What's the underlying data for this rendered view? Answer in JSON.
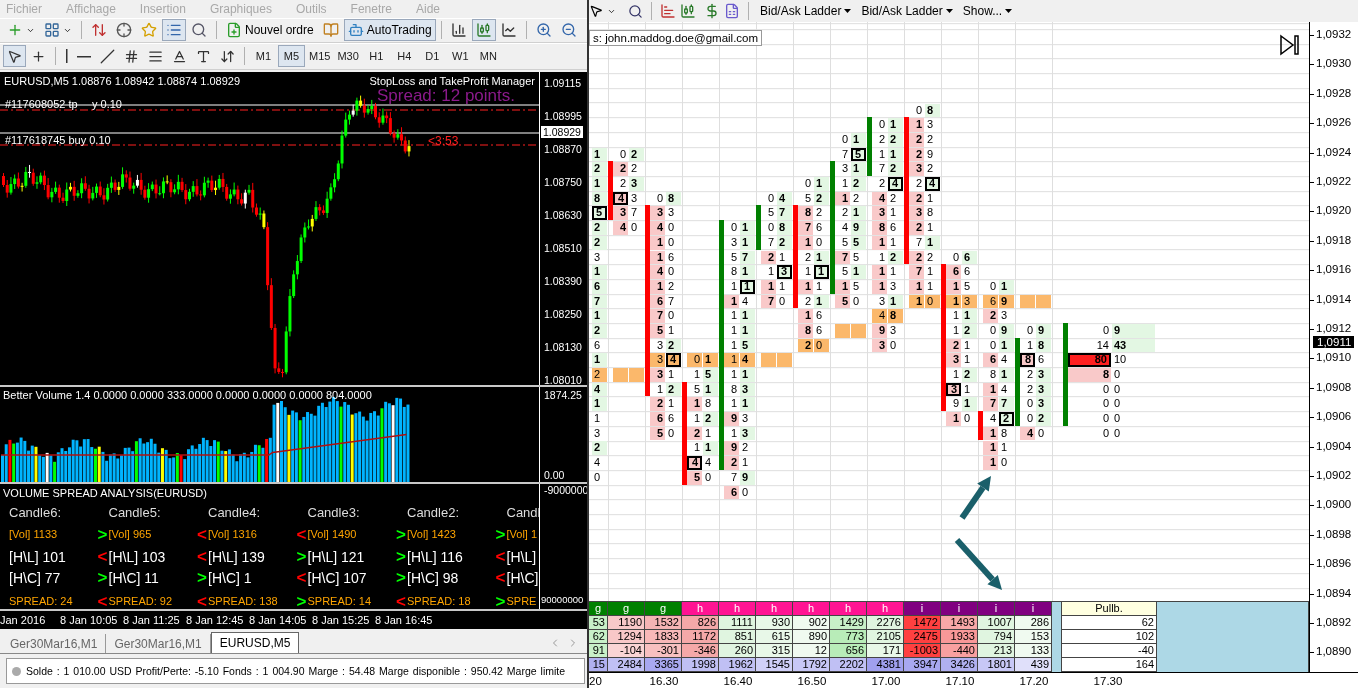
{
  "menu": [
    "Fichier",
    "Affichage",
    "Insertion",
    "Graphiques",
    "Outils",
    "Fenetre",
    "Aide"
  ],
  "toolbar": [
    {
      "pressed": false
    },
    {
      "pressed": false
    },
    {
      "pressed": false
    },
    {
      "pressed": false
    },
    {
      "pressed": false
    },
    {
      "pressed": true
    },
    {
      "pressed": false
    },
    {
      "label": "Nouvel ordre",
      "pressed": false
    },
    {
      "pressed": false
    },
    {
      "label": "AutoTrading",
      "pressed": true
    },
    {
      "pressed": false
    },
    {
      "pressed": true
    },
    {
      "pressed": false
    },
    {
      "pressed": false
    },
    {
      "pressed": false
    }
  ],
  "draw_tools": [
    {
      "pressed": true
    },
    {
      "pressed": false
    },
    {
      "pressed": false
    },
    {
      "pressed": false
    },
    {
      "pressed": false
    },
    {
      "pressed": false
    },
    {
      "pressed": false
    },
    {
      "pressed": false
    },
    {
      "pressed": false
    },
    {
      "pressed": false
    }
  ],
  "timeframes": [
    {
      "label": "M1",
      "selected": false
    },
    {
      "label": "M5",
      "selected": true
    },
    {
      "label": "M15",
      "selected": false
    },
    {
      "label": "M30",
      "selected": false
    },
    {
      "label": "H1",
      "selected": false
    },
    {
      "label": "H4",
      "selected": false
    },
    {
      "label": "D1",
      "selected": false
    },
    {
      "label": "W1",
      "selected": false
    },
    {
      "label": "MN",
      "selected": false
    }
  ],
  "chart": {
    "header": "EURUSD,M5  1.08876 1.08942 1.08874 1.08929",
    "expert": "StopLoss and TakeProfit Manager",
    "spread": "Spread: 12 points.",
    "order_line_1": [
      "#117608052 tp",
      "y 0.10"
    ],
    "order_line_2": "#117618745 buy 0.10",
    "timer": "<3:53",
    "price_labels": [
      "1.09115",
      "1.08995",
      "1.08870",
      "1.08750",
      "1.08630",
      "1.08510",
      "1.08390",
      "1.08250",
      "1.08130",
      "1.08010"
    ],
    "current_price": "1.08929"
  },
  "volume": {
    "title": "Better Volume 1.4 0.0000 0.0000 333.0000 0.0000 0.0000 0.0000 804.0000",
    "axis": [
      "1874.25",
      "0.00"
    ]
  },
  "vsa": {
    "title": "VOLUME SPREAD ANALYSIS(EURUSD)",
    "axis": [
      "-9000000",
      "90000000"
    ],
    "columns": [
      {
        "title": "Candle6:",
        "rows": [
          {
            "kind": "vol",
            "text": "[Vol] 1133"
          },
          {
            "kind": "range",
            "text": "[H\\L] 101"
          },
          {
            "kind": "range",
            "text": "[H\\C] 77"
          },
          {
            "kind": "spread",
            "text": "SPREAD: 24"
          }
        ]
      },
      {
        "title": "Candle5:",
        "rows": [
          {
            "kind": "vol",
            "arrow": ">",
            "color": "#00ff00",
            "text": "[Vol] 965"
          },
          {
            "kind": "range",
            "arrow": "<",
            "color": "#ff0000",
            "text": "[H\\L] 103"
          },
          {
            "kind": "range",
            "arrow": ">",
            "color": "#00ff00",
            "text": "[H\\C] 11"
          },
          {
            "kind": "spread",
            "arrow": "<",
            "color": "#ff0000",
            "text": "SPREAD: 92"
          }
        ]
      },
      {
        "title": "Candle4:",
        "rows": [
          {
            "kind": "vol",
            "arrow": "<",
            "color": "#ff0000",
            "text": "[Vol] 1316"
          },
          {
            "kind": "range",
            "arrow": "<",
            "color": "#ff0000",
            "text": "[H\\L] 139"
          },
          {
            "kind": "range",
            "arrow": ">",
            "color": "#00ff00",
            "text": "[H\\C] 1"
          },
          {
            "kind": "spread",
            "arrow": "<",
            "color": "#ff0000",
            "text": "SPREAD: 138"
          }
        ]
      },
      {
        "title": "Candle3:",
        "rows": [
          {
            "kind": "vol",
            "arrow": "<",
            "color": "#ff0000",
            "text": "[Vol] 1490"
          },
          {
            "kind": "range",
            "arrow": ">",
            "color": "#00ff00",
            "text": "[H\\L] 121"
          },
          {
            "kind": "range",
            "arrow": "<",
            "color": "#ff0000",
            "text": "[H\\C] 107"
          },
          {
            "kind": "spread",
            "arrow": ">",
            "color": "#00ff00",
            "text": "SPREAD: 14"
          }
        ]
      },
      {
        "title": "Candle2:",
        "rows": [
          {
            "kind": "vol",
            "arrow": ">",
            "color": "#00ff00",
            "text": "[Vol] 1423"
          },
          {
            "kind": "range",
            "arrow": ">",
            "color": "#00ff00",
            "text": "[H\\L] 116"
          },
          {
            "kind": "range",
            "arrow": ">",
            "color": "#00ff00",
            "text": "[H\\C] 98"
          },
          {
            "kind": "spread",
            "arrow": "<",
            "color": "#ff0000",
            "text": "SPREAD: 18"
          }
        ]
      },
      {
        "title": "Candl",
        "rows": [
          {
            "kind": "vol",
            "arrow": ">",
            "color": "#00ff00",
            "text": "[Vol] 1"
          },
          {
            "kind": "range",
            "arrow": "<",
            "color": "#ff0000",
            "text": "[H\\L]"
          },
          {
            "kind": "range",
            "arrow": "<",
            "color": "#ff0000",
            "text": "[H\\C]"
          },
          {
            "kind": "spread",
            "arrow": ">",
            "color": "#00ff00",
            "text": "SPRE"
          }
        ]
      }
    ]
  },
  "time_axis": [
    "Jan 2016",
    "8 Jan 10:05",
    "8 Jan 11:25",
    "8 Jan 12:45",
    "8 Jan 14:05",
    "8 Jan 15:25",
    "8 Jan 16:45"
  ],
  "chart_tabs": [
    {
      "label": "Ger30Mar16,M1",
      "selected": false
    },
    {
      "label": "Ger30Mar16,M1",
      "selected": false
    },
    {
      "label": "EURUSD,M5",
      "selected": true
    }
  ],
  "status": "Solde : 1 010.00 USD Profit/Perte: -5.10 Fonds : 1 004.90 Marge : 54.48 Marge disponible : 950.42 Marge limite",
  "ladder_menus": [
    "Bid/Ask Ladder",
    "Bid/Ask Ladder",
    "Show..."
  ],
  "tooltip": "s: john.maddog.doe@gmail.com",
  "footprint": [
    {
      "kind": "edge",
      "cells": [
        null,
        null,
        null,
        {
          "ask": "1",
          "ask_bold": true
        },
        {
          "ask": "2",
          "ask_bold": true
        },
        {
          "ask": "1",
          "ask_bold": true
        },
        {
          "ask": "8",
          "ask_bold": true
        },
        {
          "ask": "5",
          "ask_bold": true,
          "ask_boxed": true
        },
        {
          "ask": "2",
          "ask_bold": true
        },
        {
          "ask": "2",
          "ask_bold": true
        },
        {
          "ask": "3",
          "ask_bold": false
        },
        {
          "ask": "1",
          "ask_bold": true
        },
        {
          "ask": "6",
          "ask_bold": true
        },
        {
          "ask": "7",
          "ask_bold": true
        },
        {
          "ask": "1",
          "ask_bold": true
        },
        {
          "ask": "2",
          "ask_bold": true
        },
        {
          "ask": "6",
          "ask_bold": false
        },
        {
          "ask": "1",
          "ask_bold": true
        },
        {
          "ask": "2",
          "ask_bold": false,
          "poc": true
        },
        {
          "ask": "4",
          "ask_bold": true
        },
        {
          "ask": "1",
          "ask_bold": true
        },
        {
          "ask": "1",
          "ask_bold": false
        },
        {
          "ask": "3",
          "ask_bold": false
        },
        {
          "ask": "2",
          "ask_bold": true
        },
        {
          "ask": "4",
          "ask_bold": false
        },
        {
          "ask": "0",
          "ask_bold": false
        }
      ]
    },
    {
      "kind": "pair",
      "color": "#ff0000",
      "cells": [
        null,
        null,
        null,
        {
          "bid": "0",
          "ask": "2",
          "bid_bold": false,
          "ask_bold": true
        },
        {
          "bid": "2",
          "ask": "2",
          "bid_bold": true,
          "ask_bold": false,
          "bar": true
        },
        {
          "bid": "2",
          "ask": "3",
          "bid_bold": false,
          "ask_bold": true,
          "bar": true
        },
        {
          "bid": "4",
          "ask": "3",
          "bid_bold": true,
          "ask_bold": false,
          "bid_boxed": true,
          "bar": true
        },
        {
          "bid": "3",
          "ask": "7",
          "bid_bold": true,
          "ask_bold": false,
          "bar": true
        },
        {
          "bid": "4",
          "ask": "0",
          "bid_bold": true,
          "ask_bold": false
        },
        null,
        null,
        null,
        null,
        null,
        null,
        null,
        null,
        null,
        {
          "poc": true
        }
      ]
    },
    {
      "kind": "pair",
      "color": "#ff0000",
      "cells": [
        null,
        null,
        null,
        null,
        null,
        null,
        {
          "bid": "0",
          "ask": "8",
          "bid_bold": false,
          "ask_bold": true
        },
        {
          "bid": "3",
          "ask": "3",
          "bid_bold": true,
          "ask_bold": false,
          "bar": true
        },
        {
          "bid": "4",
          "ask": "0",
          "bid_bold": true,
          "ask_bold": false,
          "bar": true
        },
        {
          "bid": "1",
          "ask": "0",
          "bid_bold": true,
          "ask_bold": false,
          "bar": true
        },
        {
          "bid": "1",
          "ask": "6",
          "bid_bold": true,
          "ask_bold": false,
          "bar": true
        },
        {
          "bid": "4",
          "ask": "0",
          "bid_bold": true,
          "ask_bold": false,
          "bar": true
        },
        {
          "bid": "1",
          "ask": "2",
          "bid_bold": true,
          "ask_bold": false,
          "bar": true
        },
        {
          "bid": "6",
          "ask": "7",
          "bid_bold": true,
          "ask_bold": false,
          "bar": true
        },
        {
          "bid": "7",
          "ask": "0",
          "bid_bold": true,
          "ask_bold": false,
          "bar": true
        },
        {
          "bid": "5",
          "ask": "1",
          "bid_bold": true,
          "ask_bold": false,
          "bar": true
        },
        {
          "bid": "3",
          "ask": "2",
          "bid_bold": false,
          "ask_bold": true,
          "bar": true
        },
        {
          "bid": "3",
          "ask": "4",
          "bid_bold": false,
          "ask_bold": true,
          "ask_boxed": true,
          "poc": true,
          "bar": true
        },
        {
          "bid": "3",
          "ask": "1",
          "bid_bold": true,
          "ask_bold": false,
          "bar": true
        },
        {
          "bid": "1",
          "ask": "2",
          "bid_bold": false,
          "ask_bold": true,
          "bar": true
        },
        {
          "bid": "2",
          "ask": "1",
          "bid_bold": true,
          "ask_bold": false
        },
        {
          "bid": "6",
          "ask": "6",
          "bid_bold": true,
          "ask_bold": false
        },
        {
          "bid": "5",
          "ask": "0",
          "bid_bold": true,
          "ask_bold": false
        }
      ]
    },
    {
      "kind": "pair",
      "color": "#ff0000",
      "cells": [
        null,
        null,
        null,
        null,
        null,
        null,
        null,
        null,
        null,
        null,
        null,
        null,
        null,
        null,
        null,
        null,
        null,
        {
          "bid": "0",
          "ask": "1",
          "bid_bold": false,
          "ask_bold": true,
          "poc": true
        },
        {
          "bid": "1",
          "ask": "5",
          "bid_bold": false,
          "ask_bold": true
        },
        {
          "bid": "5",
          "ask": "1",
          "bid_bold": false,
          "ask_bold": true,
          "bar": true
        },
        {
          "bid": "1",
          "ask": "8",
          "bid_bold": true,
          "ask_bold": false,
          "bar": true
        },
        {
          "bid": "1",
          "ask": "2",
          "bid_bold": false,
          "ask_bold": true,
          "bar": true
        },
        {
          "bid": "2",
          "ask": "1",
          "bid_bold": true,
          "ask_bold": false,
          "bar": true
        },
        {
          "bid": "1",
          "ask": "1",
          "bid_bold": false,
          "ask_bold": true,
          "bar": true
        },
        {
          "bid": "4",
          "ask": "4",
          "bid_bold": true,
          "ask_bold": false,
          "bid_boxed": true,
          "bar": true
        },
        {
          "bid": "5",
          "ask": "0",
          "bid_bold": true,
          "ask_bold": false,
          "bar": true
        }
      ]
    },
    {
      "kind": "pair",
      "color": "#008000",
      "cells": [
        null,
        null,
        null,
        null,
        null,
        null,
        null,
        null,
        {
          "bid": "0",
          "ask": "1",
          "bid_bold": false,
          "ask_bold": true,
          "bar": true
        },
        {
          "bid": "3",
          "ask": "1",
          "bid_bold": false,
          "ask_bold": true,
          "bar": true
        },
        {
          "bid": "5",
          "ask": "7",
          "bid_bold": false,
          "ask_bold": true,
          "bar": true
        },
        {
          "bid": "8",
          "ask": "1",
          "bid_bold": false,
          "ask_bold": true,
          "bar": true
        },
        {
          "bid": "1",
          "ask": "1",
          "bid_bold": false,
          "ask_bold": true,
          "ask_boxed": true,
          "bar": true
        },
        {
          "bid": "1",
          "ask": "4",
          "bid_bold": true,
          "ask_bold": false,
          "bar": true
        },
        {
          "bid": "1",
          "ask": "1",
          "bid_bold": false,
          "ask_bold": true,
          "bar": true
        },
        {
          "bid": "1",
          "ask": "1",
          "bid_bold": false,
          "ask_bold": true,
          "bar": true
        },
        {
          "bid": "1",
          "ask": "5",
          "bid_bold": false,
          "ask_bold": true,
          "bar": true
        },
        {
          "bid": "1",
          "ask": "4",
          "bid_bold": false,
          "ask_bold": true,
          "poc": true,
          "bar": true
        },
        {
          "bid": "1",
          "ask": "1",
          "bid_bold": false,
          "ask_bold": true,
          "bar": true
        },
        {
          "bid": "8",
          "ask": "3",
          "bid_bold": false,
          "ask_bold": true,
          "bar": true
        },
        {
          "bid": "1",
          "ask": "1",
          "bid_bold": false,
          "ask_bold": true,
          "bar": true
        },
        {
          "bid": "9",
          "ask": "3",
          "bid_bold": true,
          "ask_bold": false,
          "bar": true
        },
        {
          "bid": "1",
          "ask": "3",
          "bid_bold": false,
          "ask_bold": true,
          "bar": true
        },
        {
          "bid": "9",
          "ask": "2",
          "bid_bold": true,
          "ask_bold": false,
          "bar": true
        },
        {
          "bid": "2",
          "ask": "1",
          "bid_bold": true,
          "ask_bold": false,
          "bar": true
        },
        {
          "bid": "7",
          "ask": "9",
          "bid_bold": false,
          "ask_bold": true
        },
        {
          "bid": "6",
          "ask": "0",
          "bid_bold": true,
          "ask_bold": false
        }
      ]
    },
    {
      "kind": "pair",
      "color": "#008000",
      "cells": [
        null,
        null,
        null,
        null,
        null,
        null,
        {
          "bid": "0",
          "ask": "4",
          "bid_bold": false,
          "ask_bold": true
        },
        {
          "bid": "5",
          "ask": "7",
          "bid_bold": false,
          "ask_bold": true,
          "bar": true
        },
        {
          "bid": "0",
          "ask": "8",
          "bid_bold": false,
          "ask_bold": true,
          "bar": true
        },
        {
          "bid": "7",
          "ask": "2",
          "bid_bold": false,
          "ask_bold": true,
          "bar": true
        },
        {
          "bid": "2",
          "ask": "1",
          "bid_bold": true,
          "ask_bold": false
        },
        {
          "bid": "1",
          "ask": "3",
          "bid_bold": false,
          "ask_bold": true,
          "ask_boxed": true
        },
        {
          "bid": "1",
          "ask": "1",
          "bid_bold": true,
          "ask_bold": false
        },
        {
          "bid": "7",
          "ask": "0",
          "bid_bold": true,
          "ask_bold": false
        },
        null,
        null,
        null,
        {
          "poc": true
        }
      ]
    },
    {
      "kind": "pair",
      "color": "#ff0000",
      "cells": [
        null,
        null,
        null,
        null,
        null,
        {
          "bid": "0",
          "ask": "1",
          "bid_bold": false,
          "ask_bold": true
        },
        {
          "bid": "5",
          "ask": "2",
          "bid_bold": false,
          "ask_bold": true
        },
        {
          "bid": "8",
          "ask": "2",
          "bid_bold": true,
          "ask_bold": false,
          "bar": true
        },
        {
          "bid": "7",
          "ask": "6",
          "bid_bold": true,
          "ask_bold": false,
          "bar": true
        },
        {
          "bid": "1",
          "ask": "0",
          "bid_bold": true,
          "ask_bold": false,
          "bar": true
        },
        {
          "bid": "2",
          "ask": "1",
          "bid_bold": false,
          "ask_bold": true,
          "bar": true
        },
        {
          "bid": "1",
          "ask": "1",
          "bid_bold": false,
          "ask_bold": true,
          "ask_boxed": true,
          "bar": true
        },
        {
          "bid": "1",
          "ask": "1",
          "bid_bold": true,
          "ask_bold": false,
          "bar": true
        },
        {
          "bid": "2",
          "ask": "1",
          "bid_bold": false,
          "ask_bold": true,
          "bar": true
        },
        {
          "bid": "1",
          "ask": "6",
          "bid_bold": true,
          "ask_bold": false
        },
        {
          "bid": "8",
          "ask": "6",
          "bid_bold": true,
          "ask_bold": false
        },
        {
          "bid": "2",
          "ask": "0",
          "bid_bold": true,
          "ask_bold": false,
          "poc": true
        }
      ]
    },
    {
      "kind": "pair",
      "color": "#008000",
      "cells": [
        null,
        null,
        {
          "bid": "0",
          "ask": "1",
          "bid_bold": false,
          "ask_bold": true
        },
        {
          "bid": "7",
          "ask": "5",
          "bid_bold": false,
          "ask_bold": true,
          "ask_boxed": true
        },
        {
          "bid": "3",
          "ask": "1",
          "bid_bold": false,
          "ask_bold": true,
          "bar": true
        },
        {
          "bid": "1",
          "ask": "2",
          "bid_bold": false,
          "ask_bold": true,
          "bar": true
        },
        {
          "bid": "1",
          "ask": "2",
          "bid_bold": true,
          "ask_bold": false,
          "bar": true
        },
        {
          "bid": "2",
          "ask": "1",
          "bid_bold": false,
          "ask_bold": true,
          "bar": true
        },
        {
          "bid": "4",
          "ask": "9",
          "bid_bold": false,
          "ask_bold": true,
          "bar": true
        },
        {
          "bid": "5",
          "ask": "5",
          "bid_bold": false,
          "ask_bold": true,
          "bar": true
        },
        {
          "bid": "7",
          "ask": "5",
          "bid_bold": true,
          "ask_bold": false,
          "bar": true
        },
        {
          "bid": "5",
          "ask": "1",
          "bid_bold": false,
          "ask_bold": true,
          "bar": true
        },
        {
          "bid": "1",
          "ask": "5",
          "bid_bold": true,
          "ask_bold": false,
          "bar": true
        },
        {
          "bid": "5",
          "ask": "0",
          "bid_bold": true,
          "ask_bold": false
        },
        null,
        {
          "poc": true
        }
      ]
    },
    {
      "kind": "pair",
      "color": "#008000",
      "cells": [
        null,
        {
          "bid": "0",
          "ask": "1",
          "bid_bold": false,
          "ask_bold": true,
          "bar": true
        },
        {
          "bid": "2",
          "ask": "2",
          "bid_bold": false,
          "ask_bold": true,
          "bar": true
        },
        {
          "bid": "1",
          "ask": "1",
          "bid_bold": false,
          "ask_bold": true,
          "bar": true
        },
        {
          "bid": "7",
          "ask": "2",
          "bid_bold": false,
          "ask_bold": true,
          "bar": true
        },
        {
          "bid": "2",
          "ask": "4",
          "bid_bold": false,
          "ask_bold": true,
          "ask_boxed": true
        },
        {
          "bid": "4",
          "ask": "2",
          "bid_bold": true,
          "ask_bold": false
        },
        {
          "bid": "3",
          "ask": "1",
          "bid_bold": true,
          "ask_bold": false
        },
        {
          "bid": "8",
          "ask": "6",
          "bid_bold": true,
          "ask_bold": false
        },
        {
          "bid": "1",
          "ask": "1",
          "bid_bold": true,
          "ask_bold": false
        },
        {
          "bid": "1",
          "ask": "2",
          "bid_bold": false,
          "ask_bold": true
        },
        {
          "bid": "1",
          "ask": "1",
          "bid_bold": true,
          "ask_bold": false
        },
        {
          "bid": "1",
          "ask": "3",
          "bid_bold": true,
          "ask_bold": false
        },
        {
          "bid": "3",
          "ask": "1",
          "bid_bold": false,
          "ask_bold": true
        },
        {
          "bid": "4",
          "ask": "8",
          "bid_bold": false,
          "ask_bold": true,
          "poc": true
        },
        {
          "bid": "9",
          "ask": "3",
          "bid_bold": true,
          "ask_bold": false
        },
        {
          "bid": "3",
          "ask": "0",
          "bid_bold": true,
          "ask_bold": false
        }
      ]
    },
    {
      "kind": "pair",
      "color": "#ff0000",
      "cells": [
        {
          "bid": "0",
          "ask": "8",
          "bid_bold": false,
          "ask_bold": true
        },
        {
          "bid": "1",
          "ask": "3",
          "bid_bold": true,
          "ask_bold": false,
          "bar": true
        },
        {
          "bid": "2",
          "ask": "2",
          "bid_bold": true,
          "ask_bold": false,
          "bar": true
        },
        {
          "bid": "2",
          "ask": "9",
          "bid_bold": true,
          "ask_bold": false,
          "bar": true
        },
        {
          "bid": "3",
          "ask": "2",
          "bid_bold": true,
          "ask_bold": false,
          "bar": true
        },
        {
          "bid": "2",
          "ask": "4",
          "bid_bold": false,
          "ask_bold": true,
          "ask_boxed": true,
          "bar": true
        },
        {
          "bid": "2",
          "ask": "1",
          "bid_bold": true,
          "ask_bold": false,
          "bar": true
        },
        {
          "bid": "3",
          "ask": "8",
          "bid_bold": true,
          "ask_bold": false,
          "bar": true
        },
        {
          "bid": "2",
          "ask": "1",
          "bid_bold": true,
          "ask_bold": false,
          "bar": true
        },
        {
          "bid": "7",
          "ask": "1",
          "bid_bold": false,
          "ask_bold": true,
          "bar": true
        },
        {
          "bid": "2",
          "ask": "2",
          "bid_bold": true,
          "ask_bold": false,
          "bar": true
        },
        {
          "bid": "7",
          "ask": "1",
          "bid_bold": true,
          "ask_bold": false
        },
        {
          "bid": "1",
          "ask": "1",
          "bid_bold": true,
          "ask_bold": false
        },
        {
          "bid": "1",
          "ask": "0",
          "bid_bold": true,
          "ask_bold": false,
          "poc": true
        }
      ]
    },
    {
      "kind": "pair",
      "color": "#ff0000",
      "cells": [
        null,
        null,
        null,
        null,
        null,
        null,
        null,
        null,
        null,
        null,
        {
          "bid": "0",
          "ask": "6",
          "bid_bold": false,
          "ask_bold": true
        },
        {
          "bid": "6",
          "ask": "6",
          "bid_bold": true,
          "ask_bold": false,
          "bar": true
        },
        {
          "bid": "1",
          "ask": "5",
          "bid_bold": true,
          "ask_bold": false,
          "bar": true
        },
        {
          "bid": "1",
          "ask": "3",
          "bid_bold": true,
          "ask_bold": false,
          "poc": true,
          "bar": true
        },
        {
          "bid": "1",
          "ask": "1",
          "bid_bold": false,
          "ask_bold": true,
          "bar": true
        },
        {
          "bid": "1",
          "ask": "2",
          "bid_bold": false,
          "ask_bold": true,
          "bar": true
        },
        {
          "bid": "2",
          "ask": "1",
          "bid_bold": true,
          "ask_bold": false,
          "bar": true
        },
        {
          "bid": "3",
          "ask": "1",
          "bid_bold": true,
          "ask_bold": false,
          "bar": true
        },
        {
          "bid": "1",
          "ask": "2",
          "bid_bold": false,
          "ask_bold": true,
          "bar": true
        },
        {
          "bid": "3",
          "ask": "1",
          "bid_bold": true,
          "ask_bold": false,
          "bid_boxed": true,
          "bar": true
        },
        {
          "bid": "9",
          "ask": "1",
          "bid_bold": false,
          "ask_bold": true,
          "bar": true
        },
        {
          "bid": "1",
          "ask": "0",
          "bid_bold": true,
          "ask_bold": false
        }
      ]
    },
    {
      "kind": "pair",
      "color": "#ff0000",
      "cells": [
        null,
        null,
        null,
        null,
        null,
        null,
        null,
        null,
        null,
        null,
        null,
        null,
        {
          "bid": "0",
          "ask": "1",
          "bid_bold": false,
          "ask_bold": true
        },
        {
          "bid": "6",
          "ask": "9",
          "bid_bold": false,
          "ask_bold": true,
          "poc": true
        },
        {
          "bid": "2",
          "ask": "3",
          "bid_bold": true,
          "ask_bold": false
        },
        {
          "bid": "0",
          "ask": "9",
          "bid_bold": false,
          "ask_bold": true
        },
        {
          "bid": "0",
          "ask": "1",
          "bid_bold": false,
          "ask_bold": true
        },
        {
          "bid": "6",
          "ask": "4",
          "bid_bold": true,
          "ask_bold": false
        },
        {
          "bid": "8",
          "ask": "1",
          "bid_bold": false,
          "ask_bold": true
        },
        {
          "bid": "1",
          "ask": "4",
          "bid_bold": true,
          "ask_bold": false
        },
        {
          "bid": "7",
          "ask": "7",
          "bid_bold": true,
          "ask_bold": true
        },
        {
          "bid": "4",
          "ask": "2",
          "bid_bold": false,
          "ask_bold": true,
          "ask_boxed": true,
          "bar": true
        },
        {
          "bid": "1",
          "ask": "8",
          "bid_bold": true,
          "ask_bold": false,
          "bar": true
        },
        {
          "bid": "1",
          "ask": "1",
          "bid_bold": true,
          "ask_bold": false
        },
        {
          "bid": "1",
          "ask": "0",
          "bid_bold": true,
          "ask_bold": false
        }
      ]
    },
    {
      "kind": "pair",
      "color": "#008000",
      "cells": [
        null,
        null,
        null,
        null,
        null,
        null,
        null,
        null,
        null,
        null,
        null,
        null,
        null,
        {
          "poc": true
        },
        null,
        {
          "bid": "0",
          "ask": "9",
          "bid_bold": false,
          "ask_bold": true
        },
        {
          "bid": "1",
          "ask": "8",
          "bid_bold": false,
          "ask_bold": true,
          "bar": true
        },
        {
          "bid": "8",
          "ask": "6",
          "bid_bold": true,
          "ask_bold": false,
          "bid_boxed": true,
          "bar": true
        },
        {
          "bid": "2",
          "ask": "3",
          "bid_bold": false,
          "ask_bold": true,
          "bar": true
        },
        {
          "bid": "2",
          "ask": "3",
          "bid_bold": false,
          "ask_bold": true,
          "bar": true
        },
        {
          "bid": "0",
          "ask": "3",
          "bid_bold": false,
          "ask_bold": true,
          "bar": true
        },
        {
          "bid": "0",
          "ask": "2",
          "bid_bold": false,
          "ask_bold": true,
          "bar": true
        },
        {
          "bid": "4",
          "ask": "0",
          "bid_bold": true,
          "ask_bold": false
        }
      ]
    },
    {
      "kind": "ladder",
      "color": "#008000",
      "cells": [
        null,
        null,
        null,
        null,
        null,
        null,
        null,
        null,
        null,
        null,
        null,
        null,
        null,
        null,
        null,
        {
          "bid": "0",
          "ask": "9",
          "bid_bold": false,
          "ask_bold": true,
          "bar": true
        },
        {
          "bid": "14",
          "ask": "43",
          "bid_bold": false,
          "ask_bold": true,
          "bar": true
        },
        {
          "bid": "80",
          "ask": "10",
          "bid_bold": true,
          "ask_bold": false,
          "bid_boxed": true,
          "bar": true
        },
        {
          "bid": "8",
          "ask": "0",
          "bid_bold": true,
          "ask_bold": false,
          "bar": true
        },
        {
          "bid": "0",
          "ask": "0",
          "bid_bold": false,
          "ask_bold": false,
          "bar": true
        },
        {
          "bid": "0",
          "ask": "0",
          "bid_bold": false,
          "ask_bold": false,
          "bar": true
        },
        {
          "bid": "0",
          "ask": "0",
          "bid_bold": false,
          "ask_bold": false,
          "bar": true
        },
        {
          "bid": "0",
          "ask": "0",
          "bid_bold": false,
          "ask_bold": false
        }
      ]
    }
  ],
  "price_axis": [
    "1,0932",
    "1,0930",
    "1,0928",
    "1,0926",
    "1,0924",
    "1,0922",
    "1,0920",
    "1,0918",
    "1,0916",
    "1,0914",
    "1,0912",
    "1,0910",
    "1,0908",
    "1,0906",
    "1,0904",
    "1,0902",
    "1,0900",
    "1,0898",
    "1,0896",
    "1,0894",
    "1,0892",
    "1,0890"
  ],
  "last_price": "1,0911",
  "summary": {
    "header": [
      {
        "label": "g",
        "color": "#008000"
      },
      {
        "label": "g",
        "color": "#008000"
      },
      {
        "label": "g",
        "color": "#008000"
      },
      {
        "label": "h",
        "color": "#ff1493"
      },
      {
        "label": "h",
        "color": "#ff1493"
      },
      {
        "label": "h",
        "color": "#ff1493"
      },
      {
        "label": "h",
        "color": "#ff1493"
      },
      {
        "label": "h",
        "color": "#ff1493"
      },
      {
        "label": "h",
        "color": "#ff1493"
      },
      {
        "label": "i",
        "color": "#800080"
      },
      {
        "label": "i",
        "color": "#800080"
      },
      {
        "label": "i",
        "color": "#800080"
      },
      {
        "label": "i",
        "color": "#800080"
      }
    ],
    "pull_header": "Pullb.",
    "rows": [
      {
        "pull": "62",
        "cells": [
          {
            "value": "53",
            "color": "#c8f0c8"
          },
          {
            "value": "1190",
            "color": "#f8c8c8"
          },
          {
            "value": "1532",
            "color": "#f4b4b4"
          },
          {
            "value": "826",
            "color": "#f4a8a8"
          },
          {
            "value": "1111",
            "color": "#dff5df"
          },
          {
            "value": "930",
            "color": "#e8f8e8"
          },
          {
            "value": "902",
            "color": "#f0faf0"
          },
          {
            "value": "1429",
            "color": "#c8f0c8"
          },
          {
            "value": "2276",
            "color": "#e0f5e0"
          },
          {
            "value": "1472",
            "color": "#ff4040"
          },
          {
            "value": "1493",
            "color": "#f8a8a8"
          },
          {
            "value": "1007",
            "color": "#e0f5e0"
          },
          {
            "value": "286",
            "color": "#f0faf0"
          }
        ]
      },
      {
        "pull": "102",
        "cells": [
          {
            "value": "62",
            "color": "#c8f0c8"
          },
          {
            "value": "1294",
            "color": "#f8c8c8"
          },
          {
            "value": "1833",
            "color": "#f8b8b8"
          },
          {
            "value": "1172",
            "color": "#f4a8a8"
          },
          {
            "value": "851",
            "color": "#e0f5e0"
          },
          {
            "value": "615",
            "color": "#e8f8e8"
          },
          {
            "value": "890",
            "color": "#f0faf0"
          },
          {
            "value": "773",
            "color": "#b8ecb8"
          },
          {
            "value": "2105",
            "color": "#e0f5e0"
          },
          {
            "value": "2475",
            "color": "#ff4040"
          },
          {
            "value": "1933",
            "color": "#f89898"
          },
          {
            "value": "794",
            "color": "#e0f5e0"
          },
          {
            "value": "153",
            "color": "#f0faf0"
          }
        ]
      },
      {
        "pull": "-40",
        "cells": [
          {
            "value": "91",
            "color": "#c8f0c8"
          },
          {
            "value": "-104",
            "color": "#fad4d4"
          },
          {
            "value": "-301",
            "color": "#f8c0c0"
          },
          {
            "value": "-346",
            "color": "#f4a8a8"
          },
          {
            "value": "260",
            "color": "#e0f5e0"
          },
          {
            "value": "315",
            "color": "#e8f8e8"
          },
          {
            "value": "12",
            "color": "#f0faf0"
          },
          {
            "value": "656",
            "color": "#b8ecb8"
          },
          {
            "value": "171",
            "color": "#e8f8e8"
          },
          {
            "value": "-1003",
            "color": "#ff4040"
          },
          {
            "value": "-440",
            "color": "#f8a0a0"
          },
          {
            "value": "213",
            "color": "#e0f5e0"
          },
          {
            "value": "133",
            "color": "#f0faf0"
          }
        ]
      },
      {
        "pull": "164",
        "cells": [
          {
            "value": "15",
            "color": "#b0b0f0"
          },
          {
            "value": "2484",
            "color": "#c0c0f4"
          },
          {
            "value": "3365",
            "color": "#a8a8f0"
          },
          {
            "value": "1998",
            "color": "#c0c0f4"
          },
          {
            "value": "1962",
            "color": "#c0c0f4"
          },
          {
            "value": "1545",
            "color": "#d0d0f8"
          },
          {
            "value": "1792",
            "color": "#c8c8f6"
          },
          {
            "value": "2202",
            "color": "#c0c0f4"
          },
          {
            "value": "4381",
            "color": "#a0a0ee"
          },
          {
            "value": "3947",
            "color": "#a8a8f0"
          },
          {
            "value": "3426",
            "color": "#b0b0f0"
          },
          {
            "value": "1801",
            "color": "#c8c8f6"
          },
          {
            "value": "439",
            "color": "#e0e0fa"
          }
        ]
      }
    ]
  },
  "time_labels": [
    "20",
    "16.30",
    "16.40",
    "16.50",
    "17.00",
    "17.10",
    "17.20",
    "17.30"
  ]
}
